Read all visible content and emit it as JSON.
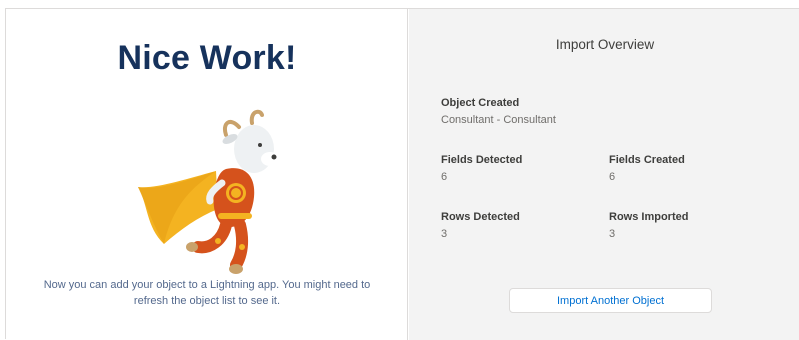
{
  "success_panel": {
    "headline": "Nice Work!",
    "mascot_icon": "goat-superhero-mascot",
    "message": "Now you can add your object to a Lightning app. You might need to refresh the object list to see it."
  },
  "overview": {
    "title": "Import Overview",
    "object_created": {
      "label": "Object Created",
      "value": "Consultant - Consultant"
    },
    "fields_detected": {
      "label": "Fields Detected",
      "value": "6"
    },
    "fields_created": {
      "label": "Fields Created",
      "value": "6"
    },
    "rows_detected": {
      "label": "Rows Detected",
      "value": "3"
    },
    "rows_imported": {
      "label": "Rows Imported",
      "value": "3"
    },
    "import_another_label": "Import Another Object"
  },
  "colors": {
    "headline": "#16325c",
    "link_blue": "#0070d2",
    "panel_gray": "#f3f3f3",
    "cape_yellow": "#f4b321",
    "suit_orange": "#d5521c"
  }
}
